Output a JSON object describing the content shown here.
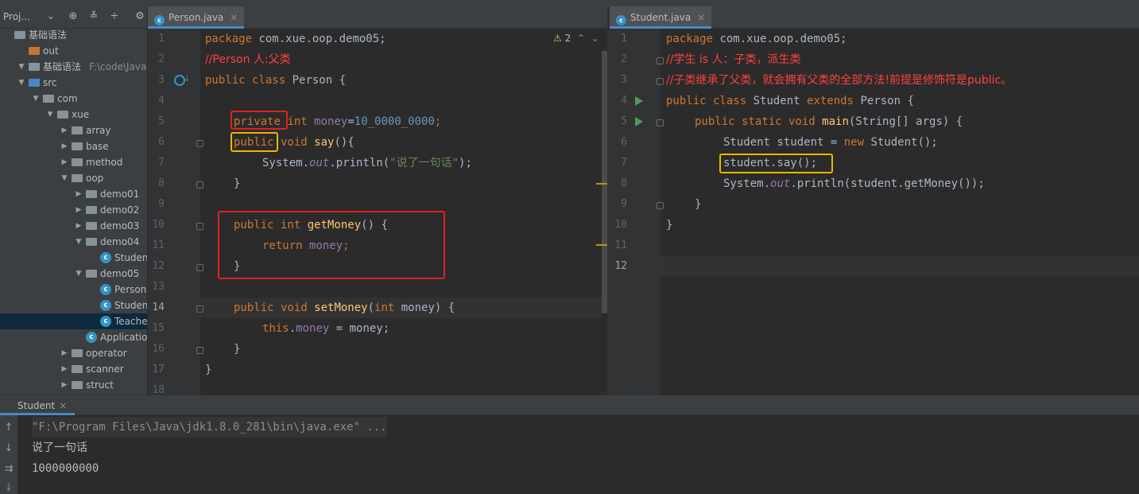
{
  "project_panel": {
    "title": "Proj...",
    "tree": [
      {
        "label": "基础语法",
        "type": "module-partial"
      },
      {
        "label": "out",
        "type": "folder-out"
      },
      {
        "label": "基础语法",
        "path": "F:\\code\\JavaSE\\基",
        "type": "module"
      },
      {
        "label": "src",
        "type": "folder-src"
      },
      {
        "label": "com",
        "type": "package"
      },
      {
        "label": "xue",
        "type": "package"
      },
      {
        "label": "array",
        "type": "package"
      },
      {
        "label": "base",
        "type": "package"
      },
      {
        "label": "method",
        "type": "package"
      },
      {
        "label": "oop",
        "type": "package"
      },
      {
        "label": "demo01",
        "type": "package"
      },
      {
        "label": "demo02",
        "type": "package"
      },
      {
        "label": "demo03",
        "type": "package"
      },
      {
        "label": "demo04",
        "type": "package"
      },
      {
        "label": "Student",
        "type": "class"
      },
      {
        "label": "demo05",
        "type": "package"
      },
      {
        "label": "Person",
        "type": "class"
      },
      {
        "label": "Student",
        "type": "class"
      },
      {
        "label": "Teacher",
        "type": "class",
        "selected": true
      },
      {
        "label": "Application",
        "type": "class"
      },
      {
        "label": "operator",
        "type": "package"
      },
      {
        "label": "scanner",
        "type": "package"
      },
      {
        "label": "struct",
        "type": "package"
      }
    ]
  },
  "left_editor": {
    "tab": "Person.java",
    "warning_count": "2",
    "line_numbers": [
      "1",
      "2",
      "3",
      "4",
      "5",
      "6",
      "7",
      "8",
      "9",
      "10",
      "11",
      "12",
      "13",
      "14",
      "15",
      "16",
      "17",
      "18"
    ],
    "lines": {
      "l1_kw": "package",
      "l1_rest": " com.xue.oop.demo05;",
      "l2": "//Person 人:父类",
      "l3_kw": "public class",
      "l3_rest": " Person {",
      "l5_kw1": "private",
      "l5_kw2": " int ",
      "l5_fld": "money",
      "l5_eq": "=",
      "l5_num": "10_0000_0000",
      "l5_end": ";",
      "l6_kw1": "public",
      "l6_kw2": " void ",
      "l6_fn": "say",
      "l6_end": "(){",
      "l7_a": "System.",
      "l7_out": "out",
      "l7_b": ".println(",
      "l7_str": "\"说了一句话\"",
      "l7_c": ");",
      "l8": "}",
      "l10_kw": "public int ",
      "l10_fn": "getMoney",
      "l10_end": "() {",
      "l11_kw": "return ",
      "l11_fld": "money",
      "l11_end": ";",
      "l12": "}",
      "l14_kw": "public void ",
      "l14_fn": "setMoney",
      "l14_a": "(",
      "l14_kw2": "int",
      "l14_b": " money) {",
      "l15_kw": "this",
      "l15_dot": ".",
      "l15_fld": "money",
      "l15_end": " = money;",
      "l16": "}",
      "l17": "}"
    }
  },
  "right_editor": {
    "tab": "Student.java",
    "line_numbers": [
      "1",
      "2",
      "3",
      "4",
      "5",
      "6",
      "7",
      "8",
      "9",
      "10",
      "11",
      "12"
    ],
    "lines": {
      "l1_kw": "package",
      "l1_rest": " com.xue.oop.demo05;",
      "l2": "//学生 is 人：子类，派生类",
      "l3": "//子类继承了父类，就会拥有父类的全部方法!前提是修饰符是public。",
      "l4_kw": "public class",
      "l4_a": " Student ",
      "l4_kw2": "extends",
      "l4_b": " Person {",
      "l5_kw": "public static void ",
      "l5_fn": "main",
      "l5_rest": "(String[] args) {",
      "l6_a": "Student student = ",
      "l6_kw": "new",
      "l6_b": " Student();",
      "l7": "student.say();",
      "l8_a": "System.",
      "l8_out": "out",
      "l8_b": ".println(student.getMoney());",
      "l9": "}",
      "l10": "}"
    }
  },
  "run_panel": {
    "tab": "Student",
    "output": [
      "\"F:\\Program Files\\Java\\jdk1.8.0_281\\bin\\java.exe\" ...",
      "说了一句话",
      "1000000000"
    ]
  },
  "colors": {
    "highlight_red": "#e02020",
    "highlight_yellow": "#f0b400",
    "keyword": "#cc7832",
    "comment_red": "#ff4040"
  }
}
